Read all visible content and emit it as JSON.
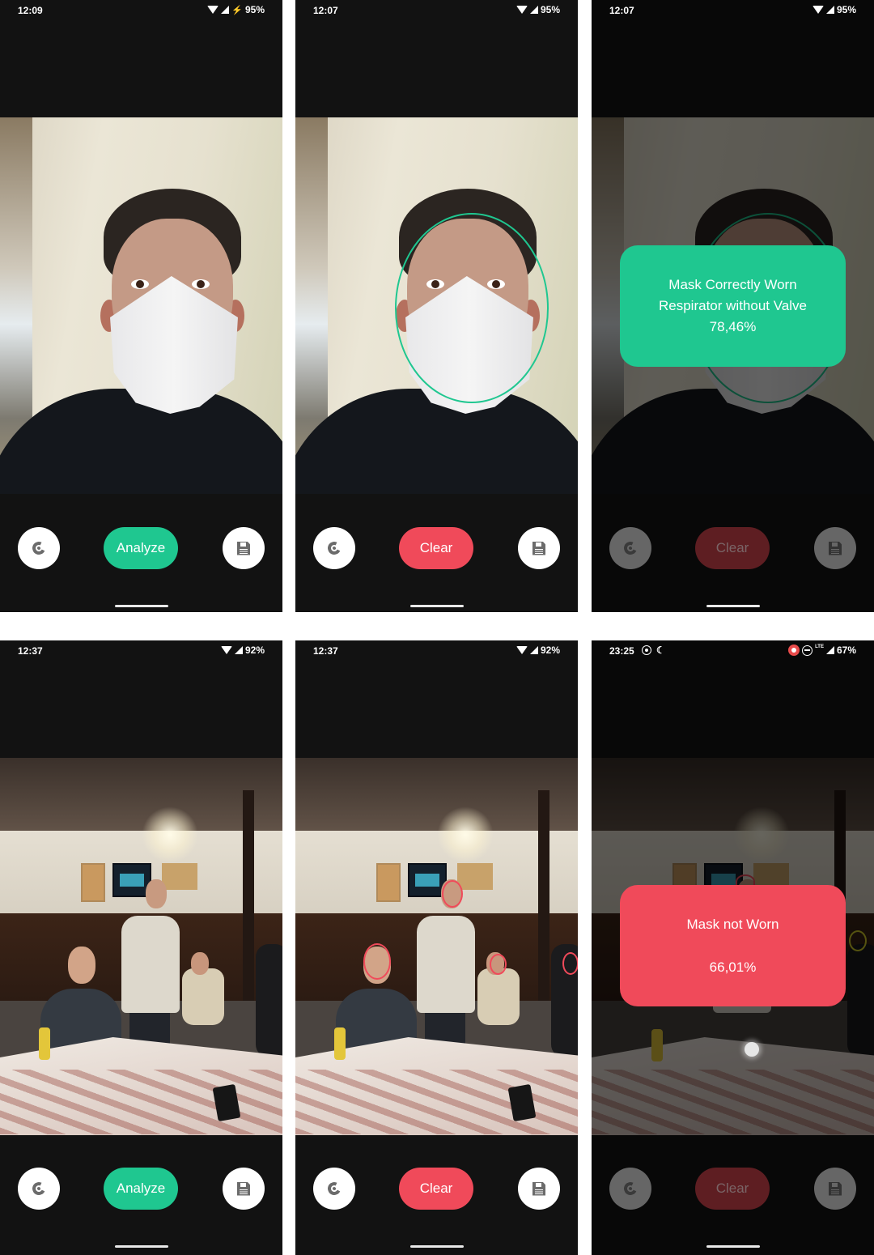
{
  "colors": {
    "accent_green": "#1fc790",
    "accent_red": "#f04a5a",
    "face_ring_yellow": "#d4cf2a",
    "background": "#121212"
  },
  "screens": [
    {
      "id": "selfie-initial",
      "status": {
        "time": "12:09",
        "battery": "95%",
        "charging": true,
        "icons": [
          "wifi-icon",
          "signal-icon",
          "charging-bolt-icon"
        ]
      },
      "scene": "person wearing respirator mask",
      "primary_button": {
        "label": "Analyze",
        "variant": "green",
        "enabled": true
      },
      "reload_icon": "reload-icon",
      "save_icon": "save-icon"
    },
    {
      "id": "selfie-detected",
      "status": {
        "time": "12:07",
        "battery": "95%",
        "icons": [
          "wifi-icon",
          "signal-icon"
        ]
      },
      "scene": "person wearing respirator mask",
      "face_rings": [
        {
          "color": "green"
        }
      ],
      "primary_button": {
        "label": "Clear",
        "variant": "red",
        "enabled": true
      }
    },
    {
      "id": "selfie-result",
      "status": {
        "time": "12:07",
        "battery": "95%",
        "icons": [
          "wifi-icon",
          "signal-icon"
        ]
      },
      "result": {
        "line1": "Mask Correctly Worn",
        "line2": "Respirator without Valve",
        "confidence": "78,46%",
        "variant": "green"
      },
      "primary_button": {
        "label": "Clear",
        "variant": "red",
        "enabled": false
      }
    },
    {
      "id": "group-initial",
      "status": {
        "time": "12:37",
        "battery": "92%",
        "icons": [
          "wifi-icon",
          "signal-icon"
        ]
      },
      "scene": "group of people in restaurant",
      "primary_button": {
        "label": "Analyze",
        "variant": "green",
        "enabled": true
      }
    },
    {
      "id": "group-detected",
      "status": {
        "time": "12:37",
        "battery": "92%",
        "icons": [
          "wifi-icon",
          "signal-icon"
        ]
      },
      "scene": "group of people in restaurant",
      "face_rings": [
        {
          "color": "red"
        },
        {
          "color": "red"
        },
        {
          "color": "red"
        },
        {
          "color": "red"
        }
      ],
      "primary_button": {
        "label": "Clear",
        "variant": "red",
        "enabled": true
      }
    },
    {
      "id": "group-result",
      "status": {
        "time": "23:25",
        "battery": "67%",
        "network": "LTE",
        "icons": [
          "screen-record-icon",
          "bedtime-icon",
          "recording-indicator-icon",
          "do-not-disturb-icon",
          "signal-icon"
        ]
      },
      "result": {
        "line1": "Mask not Worn",
        "confidence": "66,01%",
        "variant": "red"
      },
      "face_rings": [
        {
          "color": "red"
        },
        {
          "color": "yellow"
        }
      ],
      "primary_button": {
        "label": "Clear",
        "variant": "red",
        "enabled": false
      }
    }
  ]
}
